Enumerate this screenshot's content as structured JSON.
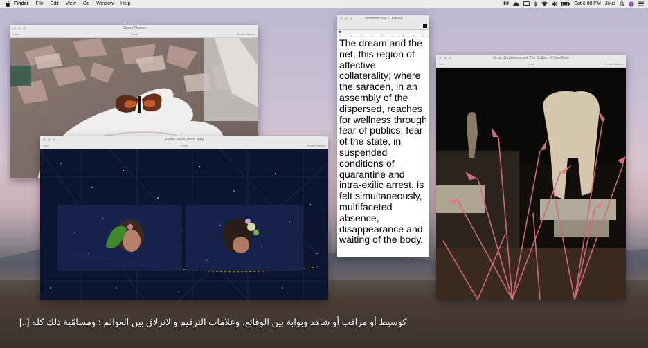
{
  "menubar": {
    "app_name": "Finder",
    "items": [
      "File",
      "Edit",
      "View",
      "Go",
      "Window",
      "Help"
    ],
    "clock": "Sat 6:08 PM",
    "user": "Joud"
  },
  "windows": {
    "gloves": {
      "title": "Gloves Flowers",
      "toolbar_left": "View",
      "toolbar_center": "Zoom",
      "toolbar_right": "Rotate  Markup"
    },
    "face_mask": {
      "title": "Jupiter- Face_Mask .jpeg",
      "toolbar_left": "View",
      "toolbar_center": "Zoom",
      "toolbar_right": "Rotate  Markup"
    },
    "statement": {
      "title": "statement.svg — Edited",
      "text": "The dream and the net, this region of affective collaterality; where the saracen, in an assembly of the dispersed, reaches for wellness through fear of publics, fear of the state, in suspended conditions of quarantine and intra-exilic arrest, is felt simultaneously, multifaceted absence, disappearance and waiting of the body."
    },
    "omar": {
      "title": "Omar, On Apomon and The Crafting of Haze2.jpg",
      "toolbar_left": "View",
      "toolbar_center": "Zoom",
      "toolbar_right": "Rotate  Markup"
    }
  },
  "caption": "كوسيط أو مراقب أو شاهد وبوابة بين الوقائع، وعلامات الترقيم والانزلاق بين العوالم ؛ ومسامّية ذلك كله [..]"
}
